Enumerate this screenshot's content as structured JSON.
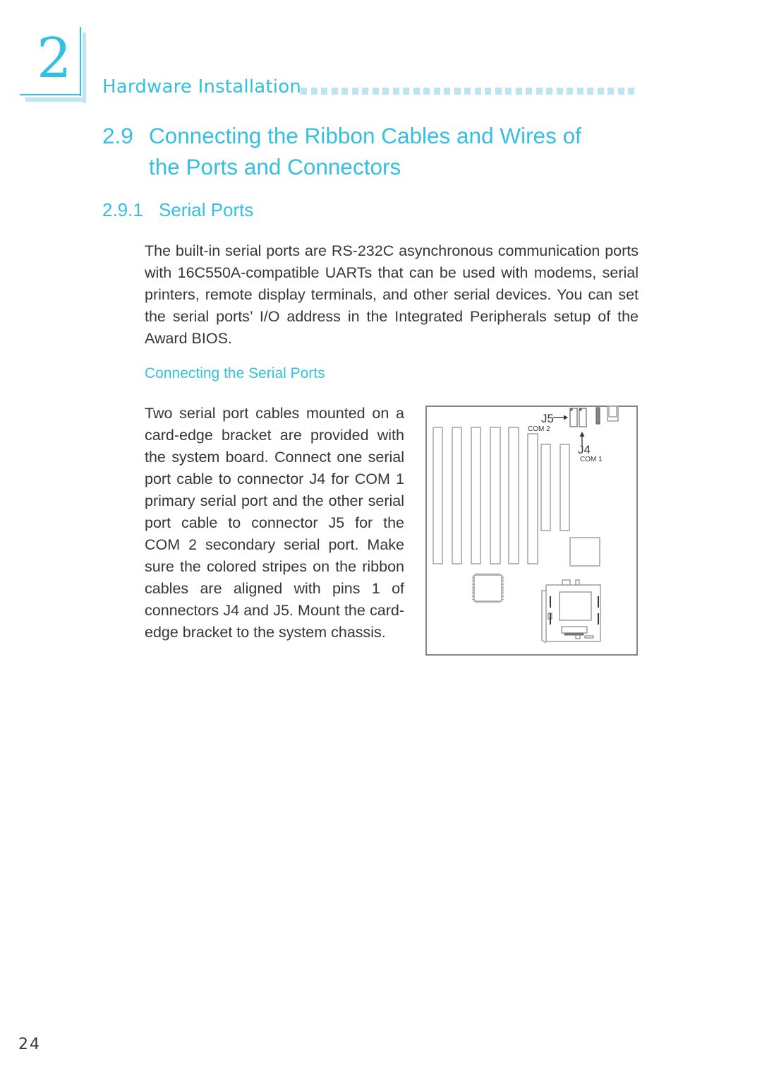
{
  "chapter": {
    "number": "2",
    "title": "Hardware Installation",
    "accent_color": "#34c0e0"
  },
  "section": {
    "number": "2.9",
    "title_line1": "Connecting the Ribbon Cables and Wires of",
    "title_line2": "the Ports and Connectors"
  },
  "subsection": {
    "number": "2.9.1",
    "title": "Serial Ports"
  },
  "body": {
    "intro_paragraph": "The built-in serial ports are RS-232C asynchronous communication ports with 16C550A-compatible UARTs that can be used with modems, serial printers, remote display terminals, and other serial devices. You can set the serial ports’ I/O address in the Integrated Peripherals setup of the Award BIOS.",
    "subheading": "Connecting the Serial Ports",
    "instructions_paragraph": "Two serial port cables mounted on a card-edge bracket are provided with the system board. Connect one serial port cable to connector J4 for COM 1 primary serial port and the other serial port cable to connector J5 for the COM 2 secondary serial port. Make sure the colored stripes on the ribbon cables are aligned with pins 1 of connectors J4 and J5. Mount the card-edge bracket to the system chassis."
  },
  "diagram": {
    "labels": {
      "j5": "J5",
      "j5_sub": "COM 2",
      "j4": "J4",
      "j4_sub": "COM 1"
    }
  },
  "footer": {
    "page_number": "24"
  }
}
